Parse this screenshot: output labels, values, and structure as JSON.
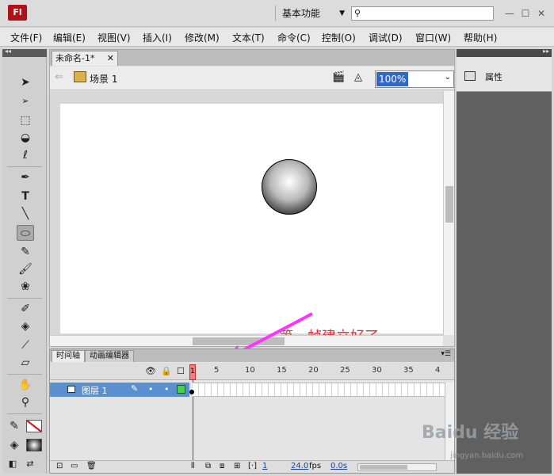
{
  "app": {
    "logo": "Fl",
    "workspace": "基本功能",
    "workspace_arrow": "▼"
  },
  "window_controls": {
    "minimize": "—",
    "maximize": "☐",
    "close": "✕"
  },
  "menu": [
    "文件(F)",
    "编辑(E)",
    "视图(V)",
    "插入(I)",
    "修改(M)",
    "文本(T)",
    "命令(C)",
    "控制(O)",
    "调试(D)",
    "窗口(W)",
    "帮助(H)"
  ],
  "document": {
    "tab_title": "未命名-1*",
    "scene": "场景 1",
    "zoom": "100%"
  },
  "annotation": "第一帧建立好了",
  "annotation_color": "#e0303a",
  "timeline": {
    "tabs": [
      "时间轴",
      "动画编辑器"
    ],
    "frame_numbers": [
      "5",
      "10",
      "15",
      "20",
      "25",
      "30",
      "35",
      "4"
    ],
    "current_frame": "1",
    "layer": {
      "name": "图层 1",
      "color": "#49d14b"
    },
    "footer": {
      "frame": "1",
      "fps": "24.0",
      "fps_unit": "fps",
      "time": "0.0s"
    }
  },
  "properties_panel": {
    "label": "属性"
  },
  "watermark": {
    "brand": "Baidu 经验",
    "url": "jingyan.baidu.com"
  }
}
